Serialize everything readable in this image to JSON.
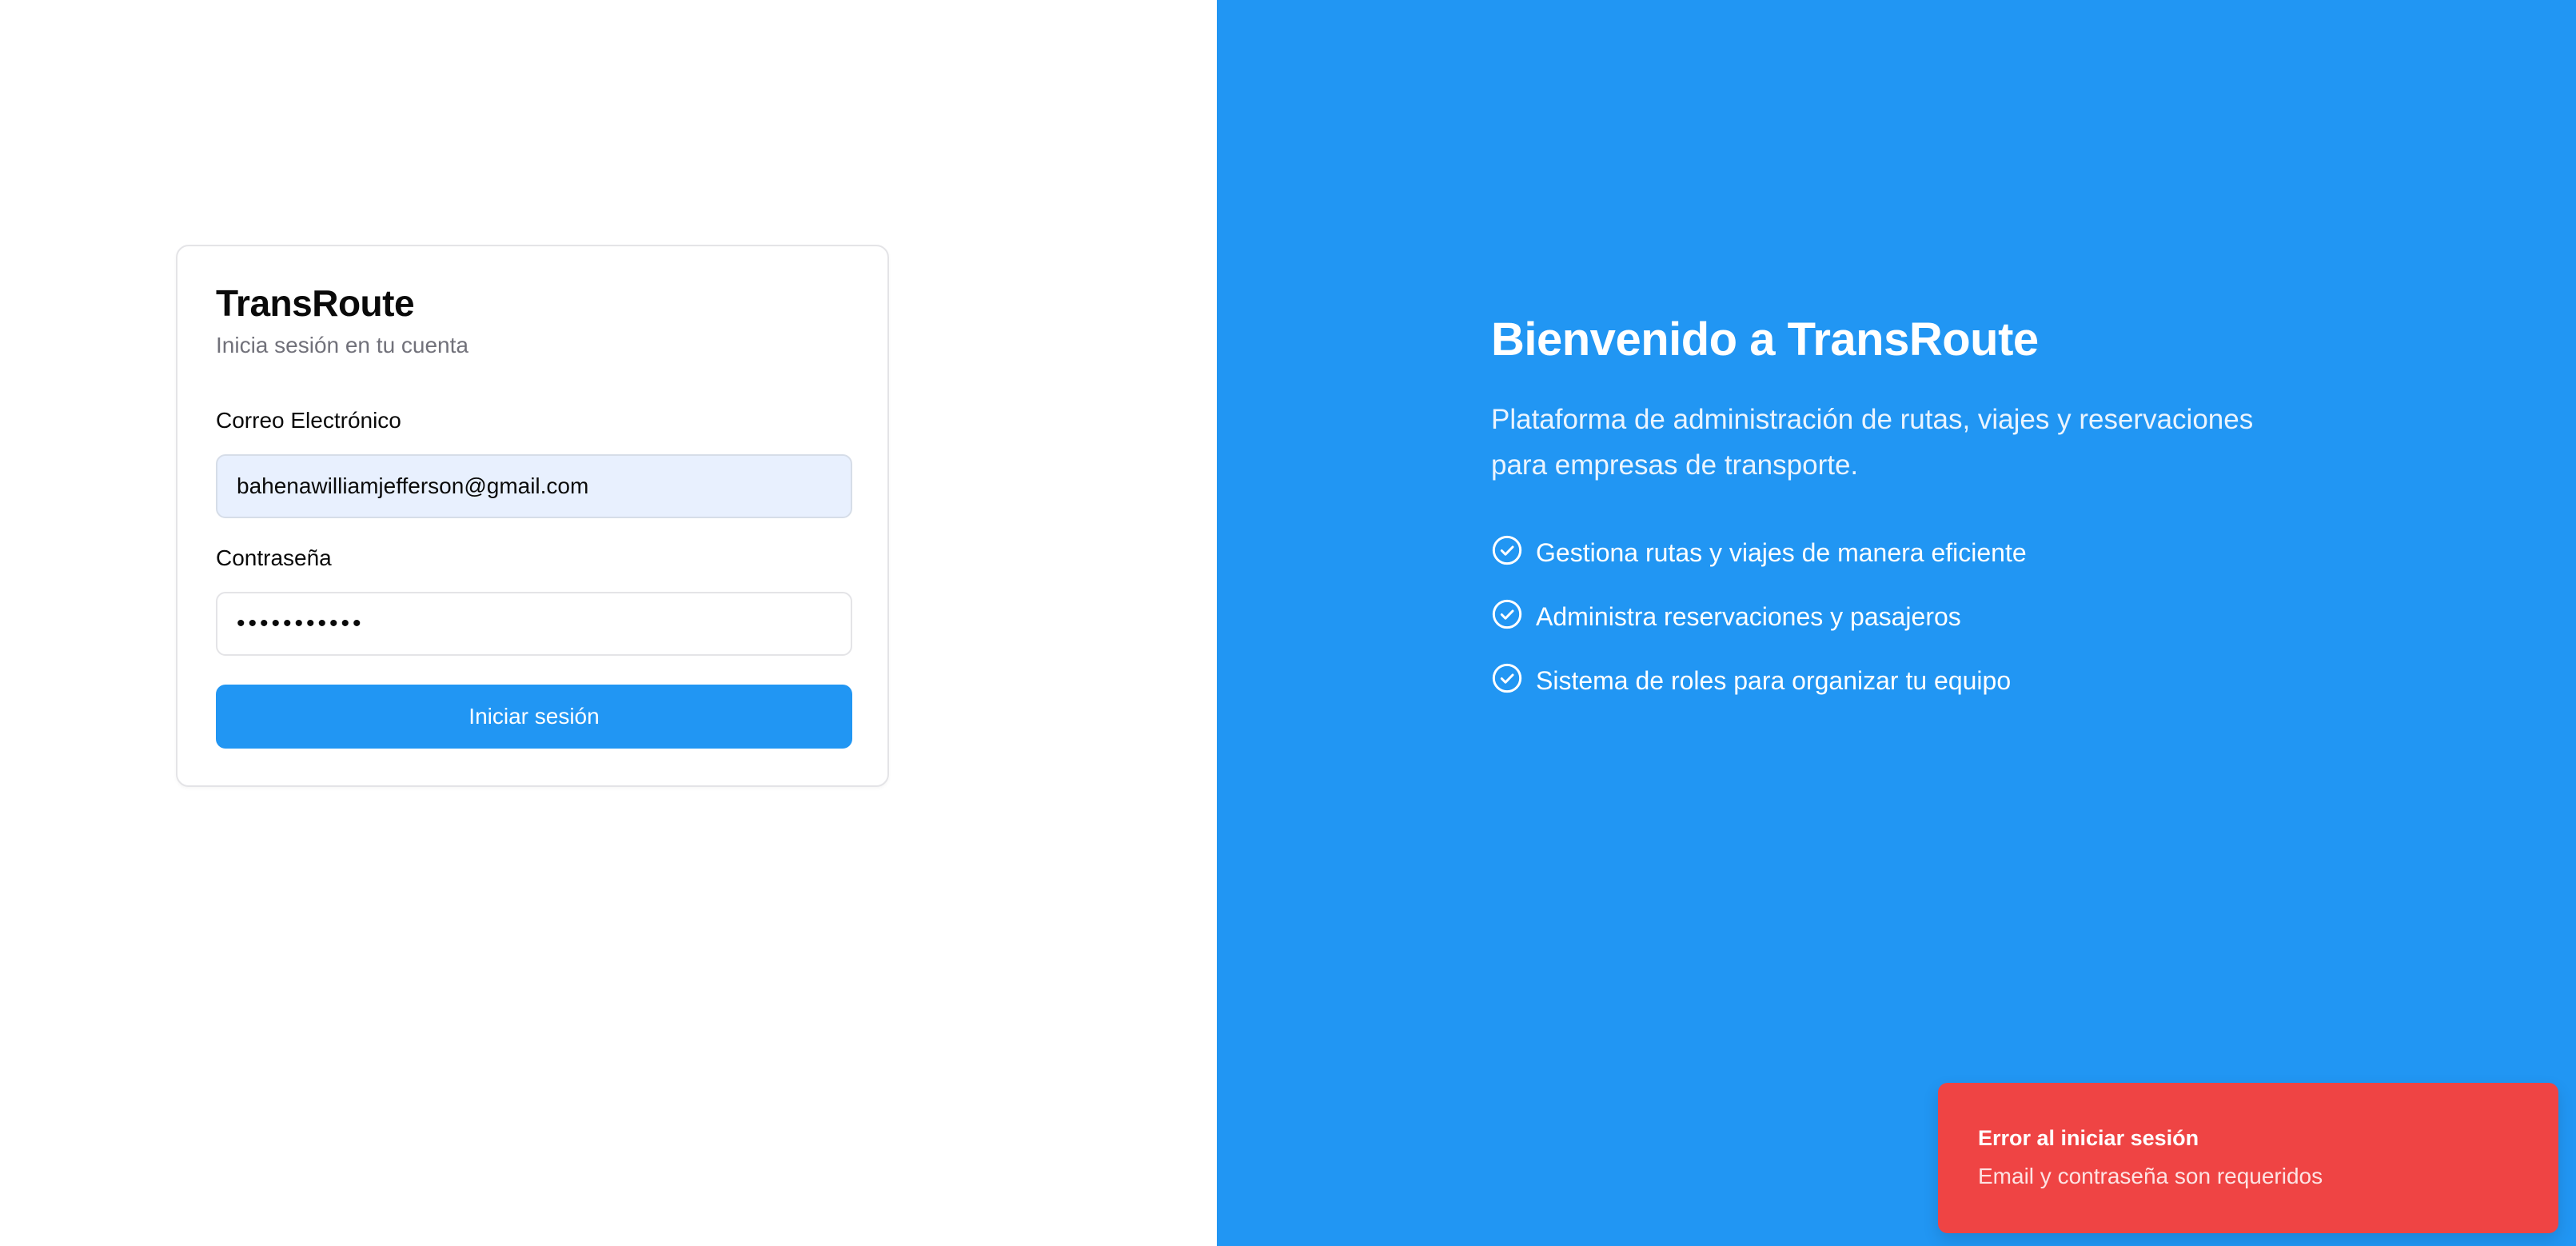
{
  "login": {
    "title": "TransRoute",
    "subtitle": "Inicia sesión en tu cuenta",
    "email_label": "Correo Electrónico",
    "email_value": "bahenawilliamjefferson@gmail.com",
    "password_label": "Contraseña",
    "password_value": "•••••••••••",
    "submit_label": "Iniciar sesión"
  },
  "welcome": {
    "title": "Bienvenido a TransRoute",
    "description": "Plataforma de administración de rutas, viajes y reservaciones para empresas de transporte.",
    "features": [
      {
        "icon": "check-circle-icon",
        "label": "Gestiona rutas y viajes de manera eficiente"
      },
      {
        "icon": "check-circle-icon",
        "label": "Administra reservaciones y pasajeros"
      },
      {
        "icon": "check-circle-icon",
        "label": "Sistema de roles para organizar tu equipo"
      }
    ]
  },
  "toast": {
    "title": "Error al iniciar sesión",
    "description": "Email y contraseña son requeridos"
  },
  "colors": {
    "primary": "#2196f3",
    "error": "#ef4444",
    "autofill": "#e8f0fe"
  }
}
